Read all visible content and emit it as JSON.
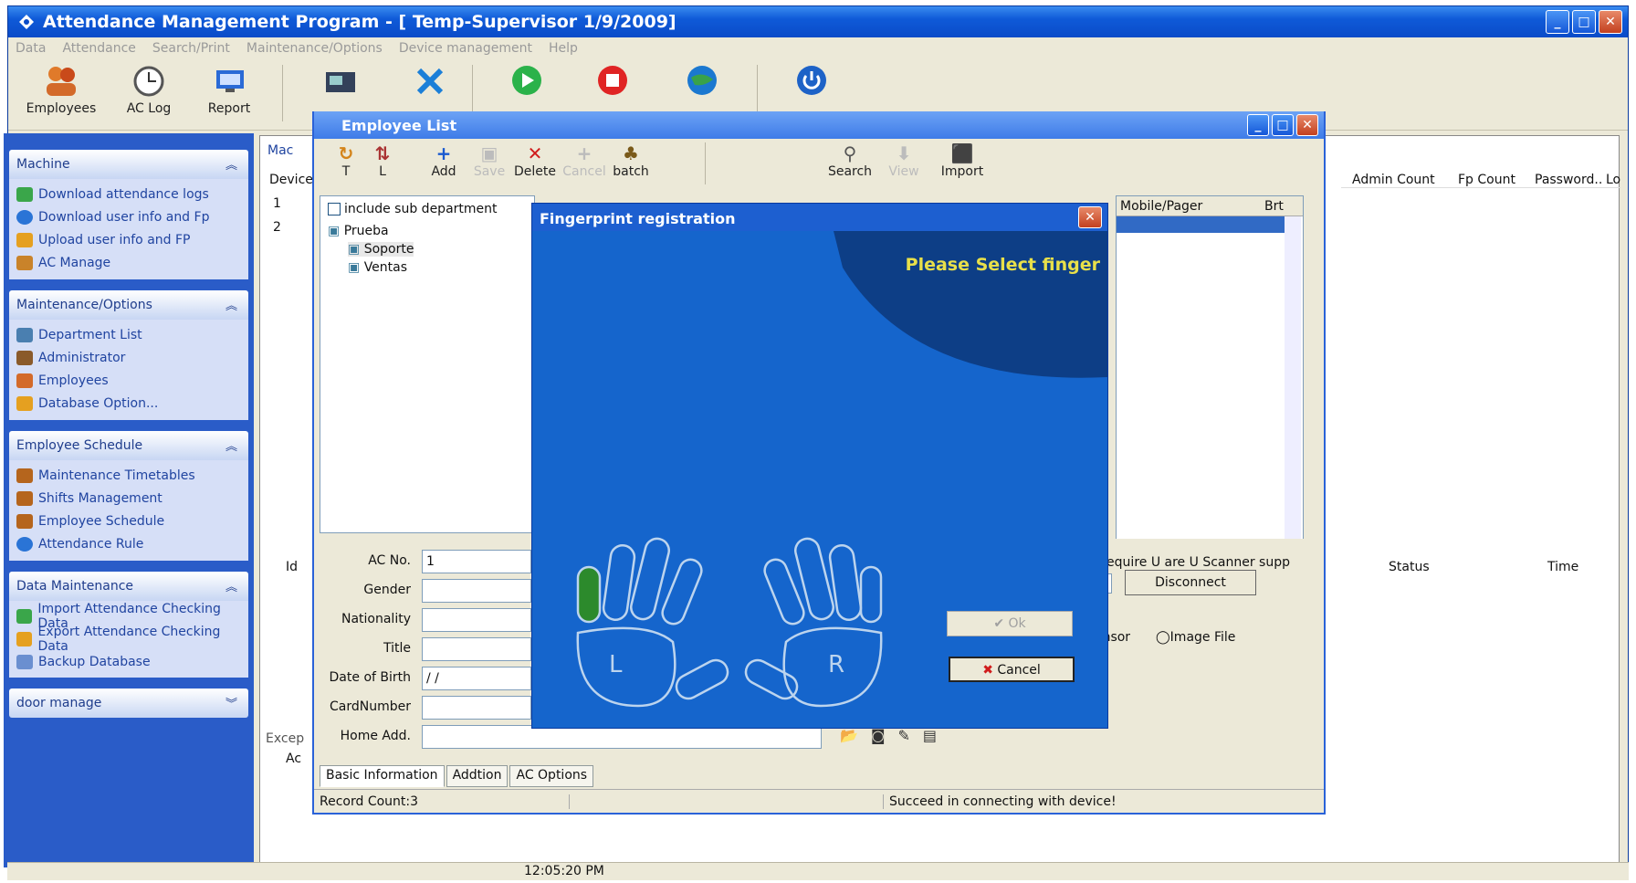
{
  "window": {
    "title": "Attendance Management Program - [ Temp-Supervisor 1/9/2009]"
  },
  "menu": [
    "Data",
    "Attendance",
    "Search/Print",
    "Maintenance/Options",
    "Device management",
    "Help"
  ],
  "toolbar": {
    "employees": "Employees",
    "ac_log": "AC Log",
    "report": "Report"
  },
  "sidebar": {
    "machine": {
      "title": "Machine",
      "items": [
        "Download attendance logs",
        "Download user info and Fp",
        "Upload user info and FP",
        "AC Manage"
      ]
    },
    "maintenance": {
      "title": "Maintenance/Options",
      "items": [
        "Department List",
        "Administrator",
        "Employees",
        "Database Option..."
      ]
    },
    "schedule": {
      "title": "Employee Schedule",
      "items": [
        "Maintenance Timetables",
        "Shifts Management",
        "Employee Schedule",
        "Attendance Rule"
      ]
    },
    "data": {
      "title": "Data Maintenance",
      "items": [
        "Import Attendance Checking Data",
        "Export Attendance Checking Data",
        "Backup Database"
      ]
    },
    "door": {
      "title": "door manage"
    }
  },
  "background": {
    "mac_label": "Mac",
    "device_col": "Device",
    "row1": "1",
    "row2": "2",
    "admin_count": "Admin Count",
    "fp_count": "Fp Count",
    "password": "Password..",
    "lc": "Lo",
    "id_col": "Id",
    "status_col": "Status",
    "time_col": "Time",
    "exception": "Excep",
    "ac": "Ac",
    "scanner_label": "ge(Require U are U Scanner supp",
    "disconnect": "Disconnect",
    "sensor": "sensor",
    "image_file": "Image File",
    "mobile_col": "Mobile/Pager",
    "birth_col": "Brt"
  },
  "employee_list": {
    "title": "Employee List",
    "tools": {
      "t": "T",
      "l": "L",
      "add": "Add",
      "save": "Save",
      "delete": "Delete",
      "cancel": "Cancel",
      "batch": "batch",
      "search": "Search",
      "view": "View",
      "import": "Import"
    },
    "include_sub": "include sub department",
    "tree": {
      "root": "Prueba",
      "children": [
        "Soporte",
        "Ventas"
      ]
    },
    "form": {
      "ac_no_label": "AC No.",
      "ac_no_value": "1",
      "gender": "Gender",
      "nationality": "Nationality",
      "title": "Title",
      "dob": "Date of Birth",
      "dob_value": "/ /",
      "card": "CardNumber",
      "home": "Home Add."
    },
    "tabs": [
      "Basic Information",
      "Addtion",
      "AC Options"
    ],
    "status": {
      "record_count": "Record Count:3",
      "message": "Succeed in connecting with device!"
    }
  },
  "dialog": {
    "title": "Fingerprint registration",
    "message": "Please Select finger",
    "ok": "Ok",
    "cancel": "Cancel",
    "left_hand": "L",
    "right_hand": "R"
  },
  "statusbar": {
    "time": "12:05:20 PM"
  }
}
